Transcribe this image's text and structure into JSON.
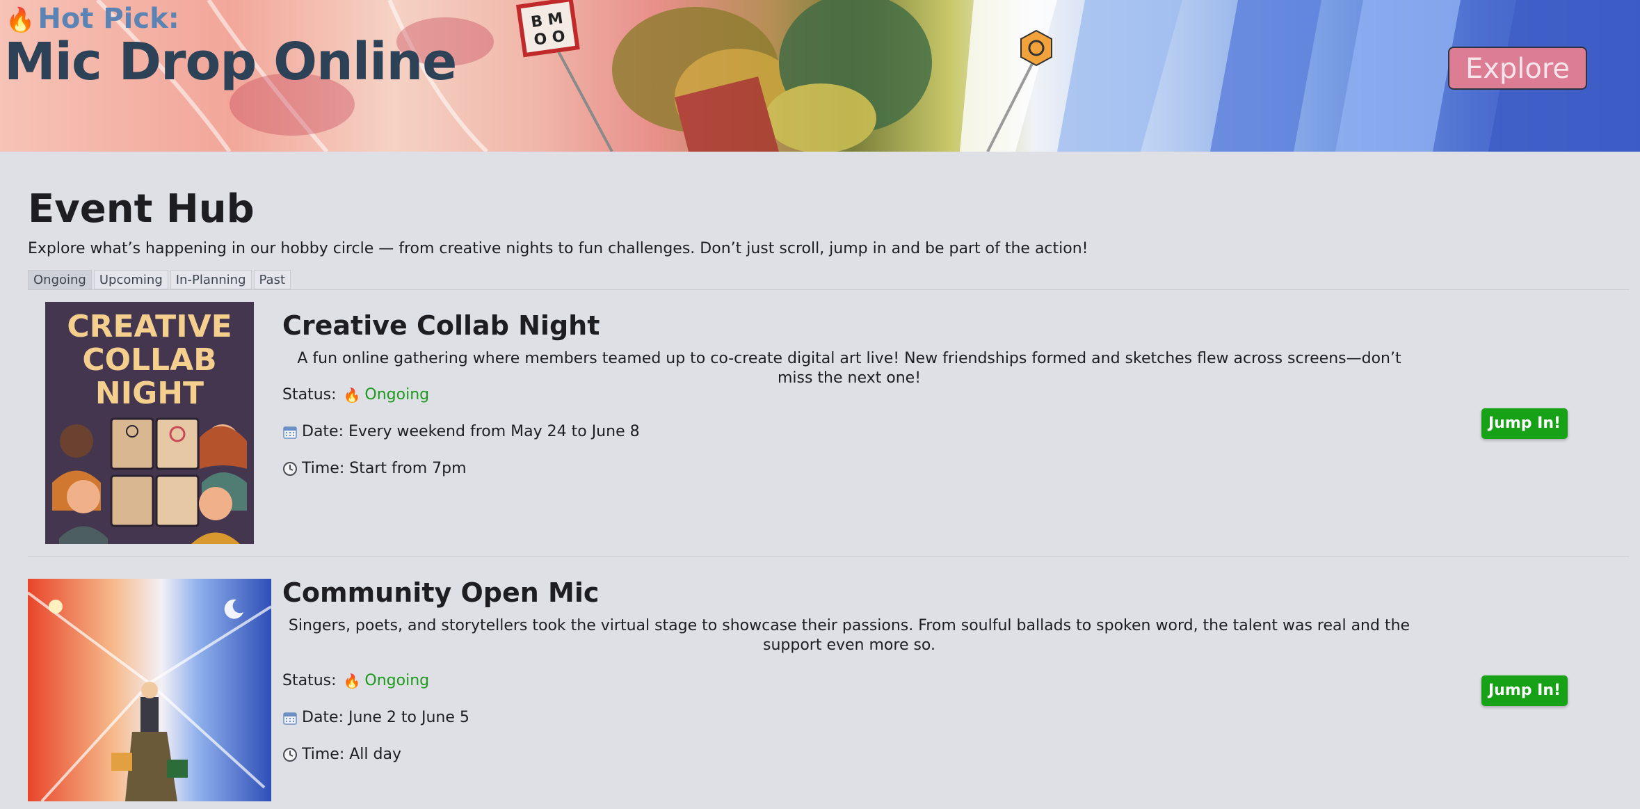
{
  "hero": {
    "kicker": "Hot Pick:",
    "kicker_icon": "fire-icon",
    "title": "Mic Drop Online",
    "explore_label": "Explore",
    "sign_text": "B M\nO O"
  },
  "main": {
    "title": "Event Hub",
    "intro": "Explore what’s happening in our hobby circle — from creative nights to fun challenges. Don’t just scroll, jump in and be part of the action!",
    "tabs": [
      {
        "label": "Ongoing",
        "active": true
      },
      {
        "label": "Upcoming",
        "active": false
      },
      {
        "label": "In-Planning",
        "active": false
      },
      {
        "label": "Past",
        "active": false
      }
    ]
  },
  "events": [
    {
      "title": "Creative Collab Night",
      "image_text": [
        "CREATIVE",
        "COLLAB",
        "NIGHT"
      ],
      "description": "A fun online gathering where members teamed up to co-create digital art live! New friendships formed and sketches flew across screens—don’t miss the next one!",
      "status_label": "Status:",
      "status_icon": "fire-icon",
      "status": "Ongoing",
      "date_icon": "calendar-icon",
      "date": "Date: Every weekend from May 24 to June 8",
      "time_icon": "clock-icon",
      "time": "Time: Start from 7pm",
      "button_label": "Jump In!"
    },
    {
      "title": "Community Open Mic",
      "description": "Singers, poets, and storytellers took the virtual stage to showcase their passions. From soulful ballads to spoken word, the talent was real and the support even more so.",
      "status_label": "Status:",
      "status_icon": "fire-icon",
      "status": "Ongoing",
      "date_icon": "calendar-icon",
      "date": "Date: June 2 to June 5",
      "time_icon": "clock-icon",
      "time": "Time: All day",
      "button_label": "Jump In!"
    }
  ],
  "colors": {
    "background": "#dfe0e6",
    "status_green": "#1b9a1b",
    "button_green": "#16a116",
    "explore_pink": "#dd7d94",
    "title_navy": "#2d4257",
    "kicker_blue": "#5b83b4"
  }
}
